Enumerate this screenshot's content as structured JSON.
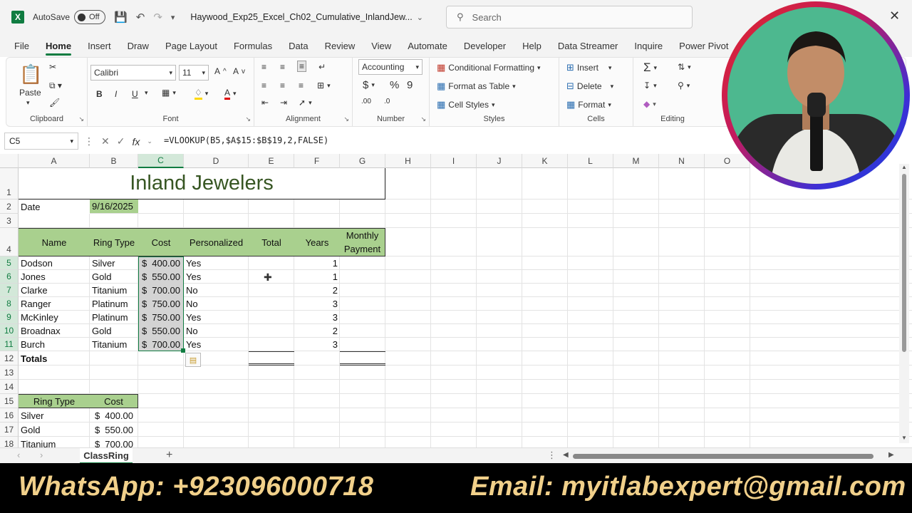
{
  "titlebar": {
    "autosave_label": "AutoSave",
    "autosave_state": "Off",
    "document_title": "Haywood_Exp25_Excel_Ch02_Cumulative_InlandJew...",
    "search_placeholder": "Search"
  },
  "ribbon_tabs": [
    "File",
    "Home",
    "Insert",
    "Draw",
    "Page Layout",
    "Formulas",
    "Data",
    "Review",
    "View",
    "Automate",
    "Developer",
    "Help",
    "Data Streamer",
    "Inquire",
    "Power Pivot"
  ],
  "ribbon": {
    "clipboard": {
      "paste": "Paste",
      "label": "Clipboard"
    },
    "font": {
      "name": "Calibri",
      "size": "11",
      "label": "Font",
      "bold": "B",
      "italic": "I",
      "underline": "U"
    },
    "alignment": {
      "label": "Alignment"
    },
    "number": {
      "format": "Accounting",
      "label": "Number"
    },
    "styles": {
      "conditional": "Conditional Formatting",
      "format_table": "Format as Table",
      "cell_styles": "Cell Styles",
      "label": "Styles"
    },
    "cells": {
      "insert": "Insert",
      "delete": "Delete",
      "format": "Format",
      "label": "Cells"
    },
    "editing": {
      "label": "Editing"
    }
  },
  "formula_bar": {
    "name_box": "C5",
    "formula": "=VLOOKUP(B5,$A$15:$B$19,2,FALSE)"
  },
  "columns": [
    "A",
    "B",
    "C",
    "D",
    "E",
    "F",
    "G",
    "H",
    "I",
    "J",
    "K",
    "L",
    "M",
    "N",
    "O"
  ],
  "rows": [
    "1",
    "2",
    "3",
    "4",
    "5",
    "6",
    "7",
    "8",
    "9",
    "10",
    "11",
    "12",
    "13",
    "14",
    "15",
    "16",
    "17",
    "18"
  ],
  "sheet": {
    "title": "Inland Jewelers",
    "date_label": "Date",
    "date_value": "9/16/2025",
    "headers": {
      "name": "Name",
      "ring_type": "Ring Type",
      "cost": "Cost",
      "personalized": "Personalized",
      "total": "Total",
      "years": "Years",
      "monthly1": "Monthly",
      "monthly2": "Payment"
    },
    "records": [
      {
        "name": "Dodson",
        "ring": "Silver",
        "cost_sym": "$",
        "cost": "400.00",
        "pers": "Yes",
        "years": "1"
      },
      {
        "name": "Jones",
        "ring": "Gold",
        "cost_sym": "$",
        "cost": "550.00",
        "pers": "Yes",
        "years": "1"
      },
      {
        "name": "Clarke",
        "ring": "Titanium",
        "cost_sym": "$",
        "cost": "700.00",
        "pers": "No",
        "years": "2"
      },
      {
        "name": "Ranger",
        "ring": "Platinum",
        "cost_sym": "$",
        "cost": "750.00",
        "pers": "No",
        "years": "3"
      },
      {
        "name": "McKinley",
        "ring": "Platinum",
        "cost_sym": "$",
        "cost": "750.00",
        "pers": "Yes",
        "years": "3"
      },
      {
        "name": "Broadnax",
        "ring": "Gold",
        "cost_sym": "$",
        "cost": "550.00",
        "pers": "No",
        "years": "2"
      },
      {
        "name": "Burch",
        "ring": "Titanium",
        "cost_sym": "$",
        "cost": "700.00",
        "pers": "Yes",
        "years": "3"
      }
    ],
    "totals_label": "Totals",
    "lookup_headers": {
      "ring_type": "Ring Type",
      "cost": "Cost"
    },
    "lookup": [
      {
        "ring": "Silver",
        "sym": "$",
        "cost": "400.00"
      },
      {
        "ring": "Gold",
        "sym": "$",
        "cost": "550.00"
      },
      {
        "ring": "Titanium",
        "sym": "$",
        "cost": "700.00"
      }
    ]
  },
  "sheet_tab": "ClassRing",
  "banner": {
    "whatsapp": "WhatsApp: +923096000718",
    "email": "Email: myitlabexpert@gmail.com"
  },
  "colors": {
    "excel_green": "#107c41",
    "header_fill": "#a9d08e",
    "title_green": "#375623"
  }
}
